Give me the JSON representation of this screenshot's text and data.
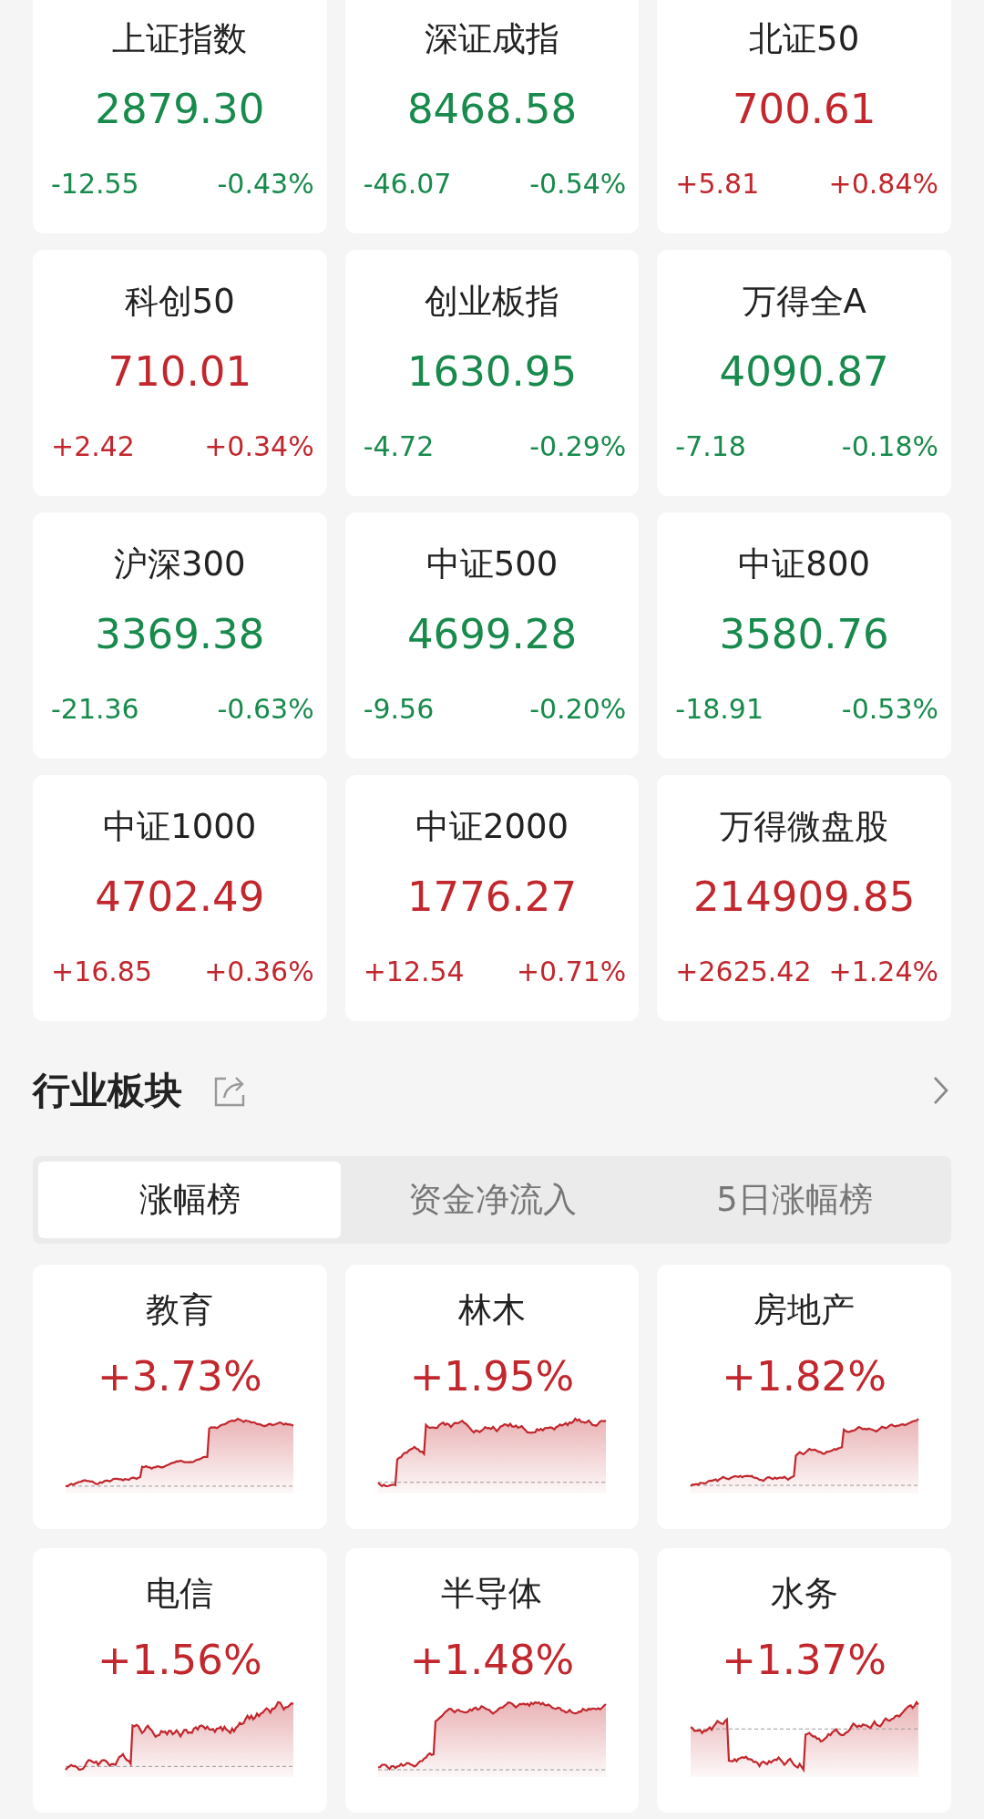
{
  "indices": [
    {
      "name": "上证指数",
      "value": "2879.30",
      "change": "-12.55",
      "percent": "-0.43%",
      "color": "#178a4c"
    },
    {
      "name": "深证成指",
      "value": "8468.58",
      "change": "-46.07",
      "percent": "-0.54%",
      "color": "#178a4c"
    },
    {
      "name": "北证50",
      "value": "700.61",
      "change": "+5.81",
      "percent": "+0.84%",
      "color": "#c1272d"
    },
    {
      "name": "科创50",
      "value": "710.01",
      "change": "+2.42",
      "percent": "+0.34%",
      "color": "#c1272d"
    },
    {
      "name": "创业板指",
      "value": "1630.95",
      "change": "-4.72",
      "percent": "-0.29%",
      "color": "#178a4c"
    },
    {
      "name": "万得全A",
      "value": "4090.87",
      "change": "-7.18",
      "percent": "-0.18%",
      "color": "#178a4c"
    },
    {
      "name": "沪深300",
      "value": "3369.38",
      "change": "-21.36",
      "percent": "-0.63%",
      "color": "#178a4c"
    },
    {
      "name": "中证500",
      "value": "4699.28",
      "change": "-9.56",
      "percent": "-0.20%",
      "color": "#178a4c"
    },
    {
      "name": "中证800",
      "value": "3580.76",
      "change": "-18.91",
      "percent": "-0.53%",
      "color": "#178a4c"
    },
    {
      "name": "中证1000",
      "value": "4702.49",
      "change": "+16.85",
      "percent": "+0.36%",
      "color": "#c1272d"
    },
    {
      "name": "中证2000",
      "value": "1776.27",
      "change": "+12.54",
      "percent": "+0.71%",
      "color": "#c1272d"
    },
    {
      "name": "万得微盘股",
      "value": "214909.85",
      "change": "+2625.42",
      "percent": "+1.24%",
      "color": "#c1272d"
    }
  ],
  "sector_section": {
    "title": "行业板块",
    "tabs": [
      {
        "label": "涨幅榜",
        "selected": true
      },
      {
        "label": "资金净流入",
        "selected": false
      },
      {
        "label": "5日涨幅榜",
        "selected": false
      }
    ],
    "sectors": [
      {
        "name": "教育",
        "percent": "+3.73%",
        "color": "#c1272d"
      },
      {
        "name": "林木",
        "percent": "+1.95%",
        "color": "#c1272d"
      },
      {
        "name": "房地产",
        "percent": "+1.82%",
        "color": "#c1272d"
      },
      {
        "name": "电信",
        "percent": "+1.56%",
        "color": "#c1272d"
      },
      {
        "name": "半导体",
        "percent": "+1.48%",
        "color": "#c1272d"
      },
      {
        "name": "水务",
        "percent": "+1.37%",
        "color": "#c1272d"
      }
    ]
  }
}
